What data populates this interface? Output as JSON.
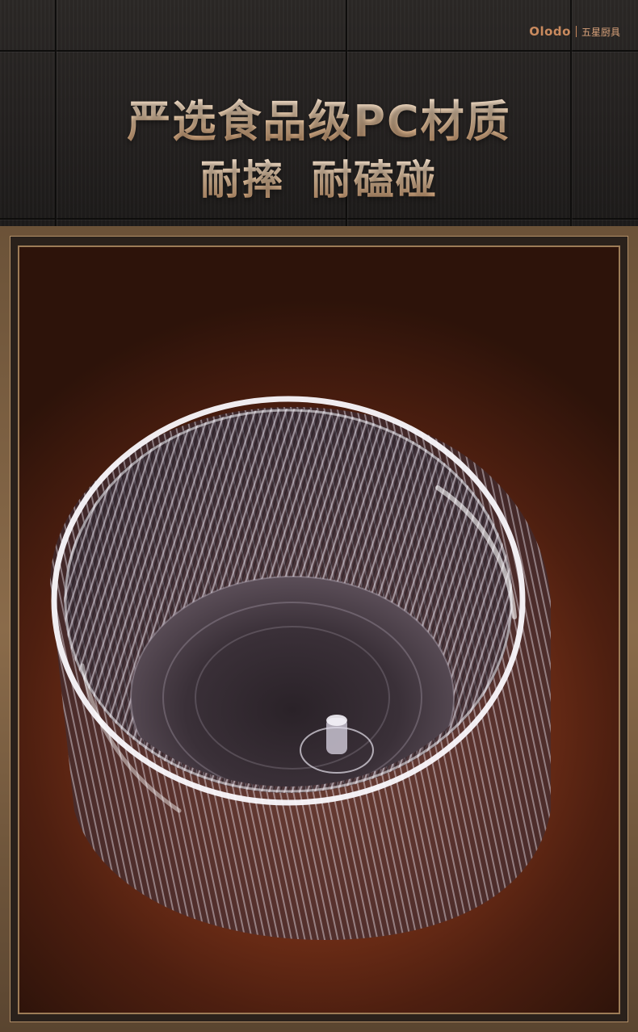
{
  "brand": {
    "logo": "Olodo",
    "tagline": "五星厨具"
  },
  "headline": {
    "line1": "严选食品级PC材质",
    "line2": "耐摔 耐磕碰"
  },
  "product": {
    "icon": "transparent-ribbed-cup-image",
    "colors": {
      "background_center": "#a44d27",
      "background_edge": "#2d130a",
      "frame_gold": "#b08e67"
    }
  }
}
